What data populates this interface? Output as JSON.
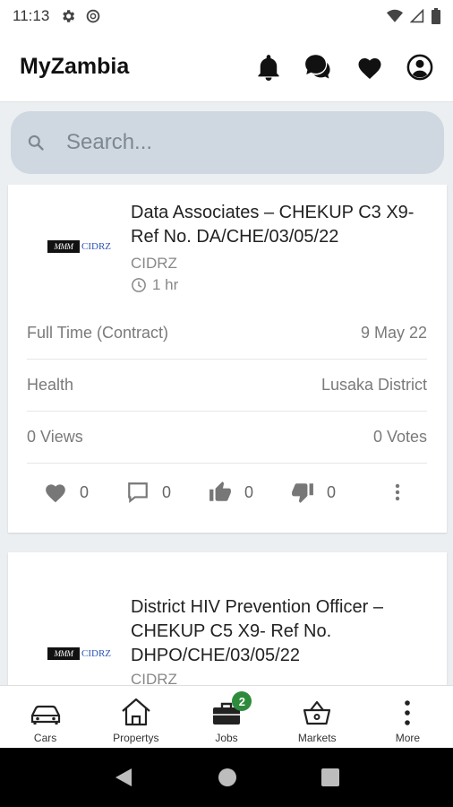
{
  "status_bar": {
    "time": "11:13"
  },
  "app_bar": {
    "title": "MyZambia"
  },
  "search": {
    "placeholder": "Search..."
  },
  "jobs": [
    {
      "logo_text": "CIDRZ",
      "title": "Data Associates – CHEKUP C3 X9- Ref No. DA/CHE/03/05/22",
      "company": "CIDRZ",
      "posted": "1 hr",
      "type": "Full Time (Contract)",
      "date": "9 May 22",
      "category": "Health",
      "location": "Lusaka District",
      "views": "0 Views",
      "votes": "0 Votes",
      "likes": "0",
      "comments": "0",
      "upvotes": "0",
      "downvotes": "0"
    },
    {
      "logo_text": "CIDRZ",
      "title": "District HIV Prevention Officer – CHEKUP C5 X9- Ref No. DHPO/CHE/03/05/22",
      "company": "CIDRZ"
    }
  ],
  "bottom_nav": {
    "items": [
      {
        "label": "Cars",
        "icon": "car-icon"
      },
      {
        "label": "Propertys",
        "icon": "house-icon"
      },
      {
        "label": "Jobs",
        "icon": "briefcase-icon",
        "badge": "2"
      },
      {
        "label": "Markets",
        "icon": "basket-icon"
      },
      {
        "label": "More",
        "icon": "more-vertical-icon"
      }
    ]
  },
  "colors": {
    "badge": "#2e8b3c",
    "search_bg": "#cfd8e0",
    "logo_text": "#2b53b5"
  }
}
